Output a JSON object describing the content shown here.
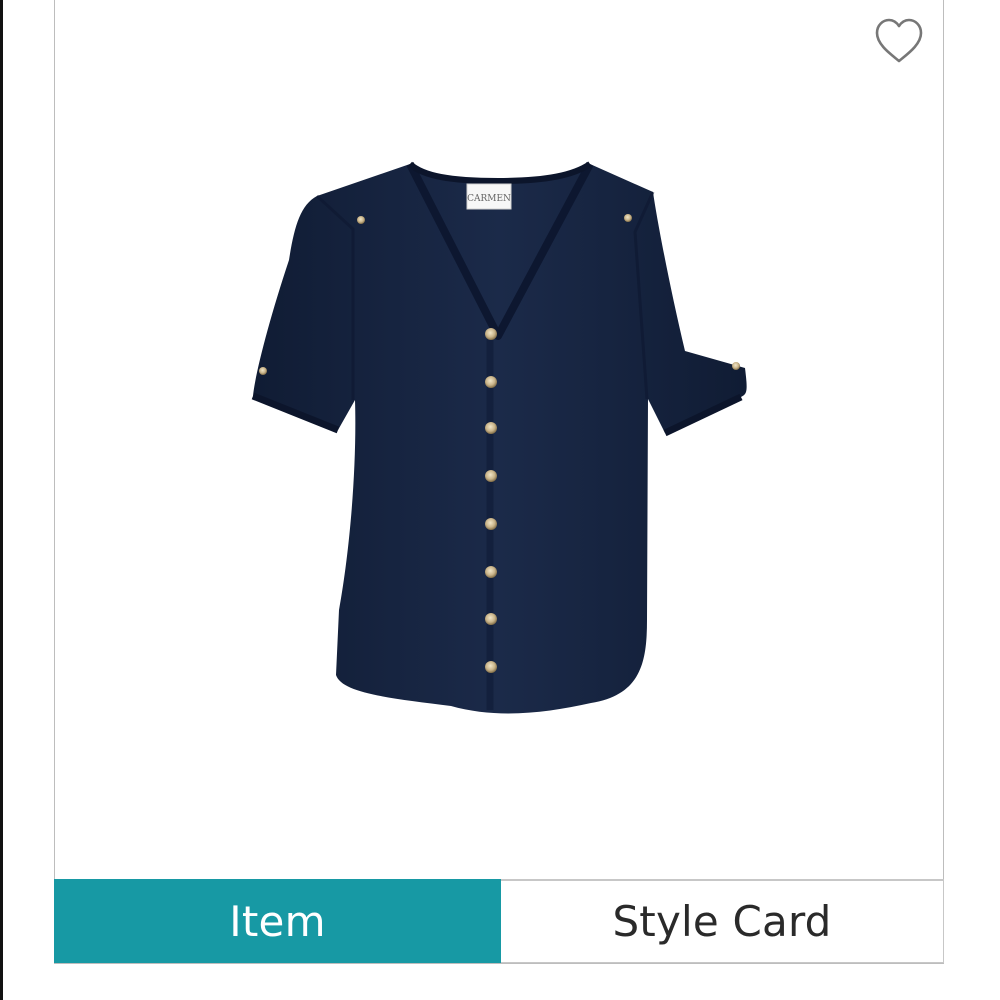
{
  "product": {
    "label_text": "CARMEN"
  },
  "favorite": {
    "icon": "heart-outline-icon"
  },
  "tabs": [
    {
      "label": "Item",
      "active": true
    },
    {
      "label": "Style Card",
      "active": false
    }
  ],
  "colors": {
    "accent": "#1799a4",
    "garment": "#172542",
    "button_gold": "#c9b48a",
    "border": "#bdbdbd"
  }
}
